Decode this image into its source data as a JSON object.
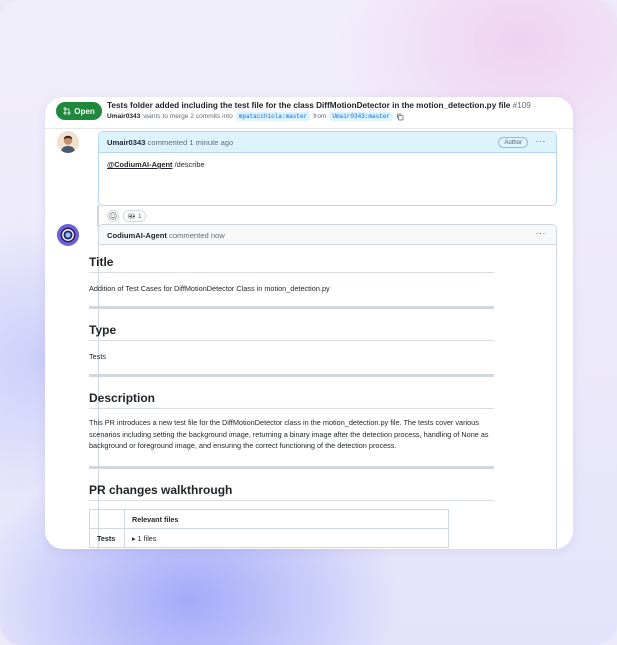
{
  "pr": {
    "state": "Open",
    "title": "Tests folder added including the test file for the class DiffMotionDetector in the motion_detection.py file",
    "number": "#109",
    "author": "Umair0343",
    "merge_text": "wants to merge 2 commits into",
    "base_branch": "mpatacchiola:master",
    "from_text": "from",
    "head_branch": "Umair0343:master",
    "colors": {
      "open": "#1f883d",
      "link": "#0969da"
    }
  },
  "comment1": {
    "author": "Umair0343",
    "meta": "commented 1 minute ago",
    "badge": "Author",
    "menu": "···",
    "mention": "@CodiumAI-Agent",
    "command": "/describe",
    "reaction_count": "1"
  },
  "comment2": {
    "author": "CodiumAI-Agent",
    "meta": "commented now",
    "menu": "···",
    "title_heading": "Title",
    "title_text": "Addition of Test Cases for DiffMotionDetector Class in motion_detection.py",
    "type_heading": "Type",
    "type_text": "Tests",
    "description_heading": "Description",
    "description_text": "This PR introduces a new test file for the DiffMotionDetector class in the motion_detection.py file. The tests cover various scenarios including setting the background image, returning a binary image after the detection process, handling of None as background or foreground image, and ensuring the correct functioning of the detection process.",
    "walkthrough_heading": "PR changes walkthrough",
    "table": {
      "header": [
        "",
        "Relevant files"
      ],
      "rows": [
        [
          "Tests",
          "▸ 1 files"
        ]
      ]
    }
  }
}
